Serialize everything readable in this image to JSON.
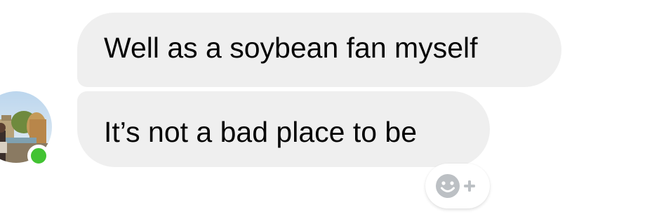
{
  "messages": [
    {
      "text": "Well as a soybean fan myself"
    },
    {
      "text": "It’s not a bad place to be"
    }
  ],
  "sender": {
    "online": true,
    "presence_color": "#42c332"
  },
  "reaction": {
    "icon": "smiley-add-icon"
  },
  "colors": {
    "bubble": "#efefef",
    "text": "#050505",
    "background": "#ffffff",
    "reaction_icon": "#bcc0c4"
  }
}
